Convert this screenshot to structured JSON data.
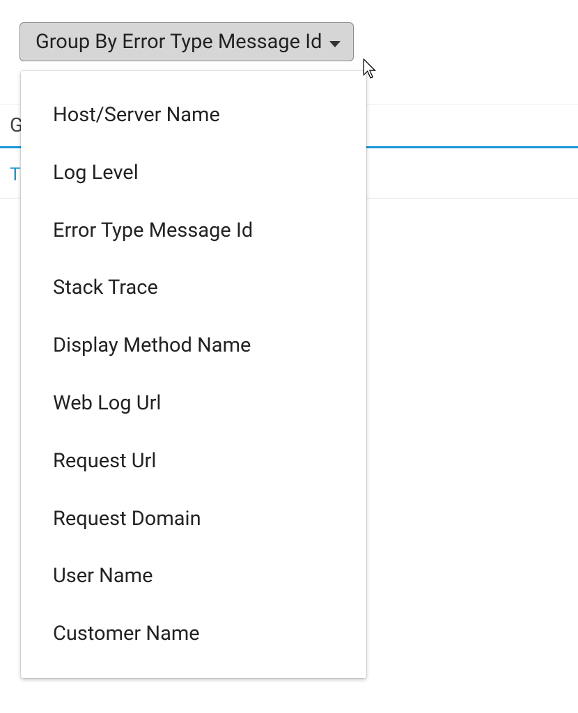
{
  "dropdown": {
    "button_label": "Group By Error Type Message Id",
    "options": [
      "Host/Server Name",
      "Log Level",
      "Error Type Message Id",
      "Stack Trace",
      "Display Method Name",
      "Web Log Url",
      "Request Url",
      "Request Domain",
      "User Name",
      "Customer Name"
    ]
  },
  "background": {
    "header_partial": "G",
    "tab_partial": "T"
  }
}
